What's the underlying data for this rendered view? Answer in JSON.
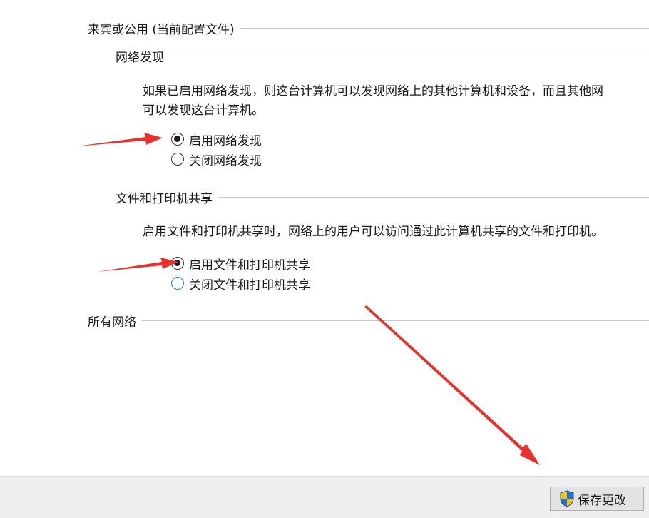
{
  "profile": {
    "header": "来宾或公用 (当前配置文件)",
    "network_discovery": {
      "header": "网络发现",
      "description_line1": "如果已启用网络发现，则这台计算机可以发现网络上的其他计算机和设备，而且其他网",
      "description_line2": "可以发现这台计算机。",
      "options": [
        {
          "label": "启用网络发现",
          "selected": true
        },
        {
          "label": "关闭网络发现",
          "selected": false
        }
      ]
    },
    "file_printer_sharing": {
      "header": "文件和打印机共享",
      "description": "启用文件和打印机共享时，网络上的用户可以访问通过此计算机共享的文件和打印机。",
      "options": [
        {
          "label": "启用文件和打印机共享",
          "selected": true
        },
        {
          "label": "关闭文件和打印机共享",
          "selected": false
        }
      ]
    }
  },
  "all_networks": {
    "header": "所有网络"
  },
  "footer": {
    "save_label": "保存更改",
    "save_icon": "uac-shield-icon"
  },
  "annotations": {
    "arrow_color": "#e8312a"
  },
  "colors": {
    "rule": "#c8c8c8",
    "footer_bg": "#efefef",
    "radio_hover": "#1e7ad6"
  }
}
